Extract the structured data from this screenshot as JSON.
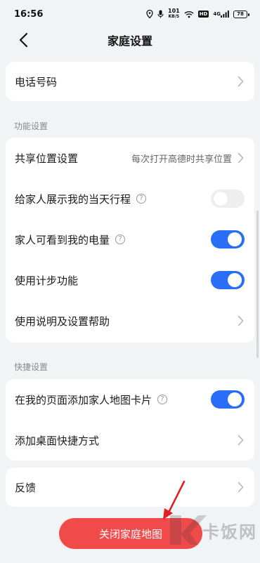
{
  "status_bar": {
    "time": "16:56",
    "net_speed": "101",
    "net_unit": "KB/S",
    "hd": "HD",
    "signal": "4G",
    "battery": "78"
  },
  "header": {
    "title": "家庭设置"
  },
  "phone_row": {
    "label": "电话号码"
  },
  "function_section": {
    "title": "功能设置",
    "items": [
      {
        "label": "共享位置设置",
        "value": "每次打开高德时共享位置"
      },
      {
        "label": "给家人展示我的当天行程",
        "toggle": false
      },
      {
        "label": "家人可看到我的电量",
        "toggle": true
      },
      {
        "label": "使用计步功能",
        "toggle": true
      },
      {
        "label": "使用说明及设置帮助"
      }
    ]
  },
  "shortcut_section": {
    "title": "快捷设置",
    "items": [
      {
        "label": "在我的页面添加家人地图卡片",
        "toggle": true
      },
      {
        "label": "添加桌面快捷方式"
      }
    ]
  },
  "feedback_row": {
    "label": "反馈"
  },
  "close_button": {
    "label": "关闭家庭地图"
  },
  "watermark": {
    "text": "卡饭网"
  },
  "colors": {
    "toggle_on": "#2a6df6",
    "close_button": "#f04a4a",
    "annotation_arrow": "#e02020",
    "background": "#f2f3f5"
  }
}
